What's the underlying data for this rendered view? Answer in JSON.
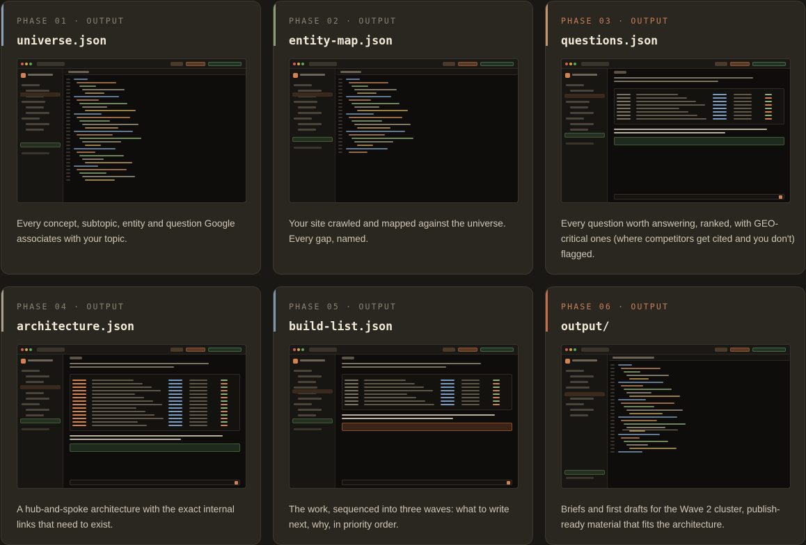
{
  "cards": [
    {
      "phase": "PHASE 01 · OUTPUT",
      "file": "universe.json",
      "desc": "Every concept, subtopic, entity and question Google associates with your topic.",
      "accent": "#8aa0b8",
      "warm": false
    },
    {
      "phase": "PHASE 02 · OUTPUT",
      "file": "entity-map.json",
      "desc": "Your site crawled and mapped against the universe. Every gap, named.",
      "accent": "#8a9c7a",
      "warm": false
    },
    {
      "phase": "PHASE 03 · OUTPUT",
      "file": "questions.json",
      "desc": "Every question worth answering, ranked, with GEO-critical ones (where competitors get cited and you don't) flagged.",
      "accent": "#c4956a",
      "warm": true
    },
    {
      "phase": "PHASE 04 · OUTPUT",
      "file": "architecture.json",
      "desc": "A hub-and-spoke architecture with the exact internal links that need to exist.",
      "accent": "#a89f8c",
      "warm": false
    },
    {
      "phase": "PHASE 05 · OUTPUT",
      "file": "build-list.json",
      "desc": "The work, sequenced into three waves: what to write next, why, in priority order.",
      "accent": "#7b98b0",
      "warm": false
    },
    {
      "phase": "PHASE 06 · OUTPUT",
      "file": "output/",
      "desc": "Briefs and first drafts for the Wave 2 cluster, publish-ready material that fits the architecture.",
      "accent": "#c46e4a",
      "warm": true
    }
  ]
}
